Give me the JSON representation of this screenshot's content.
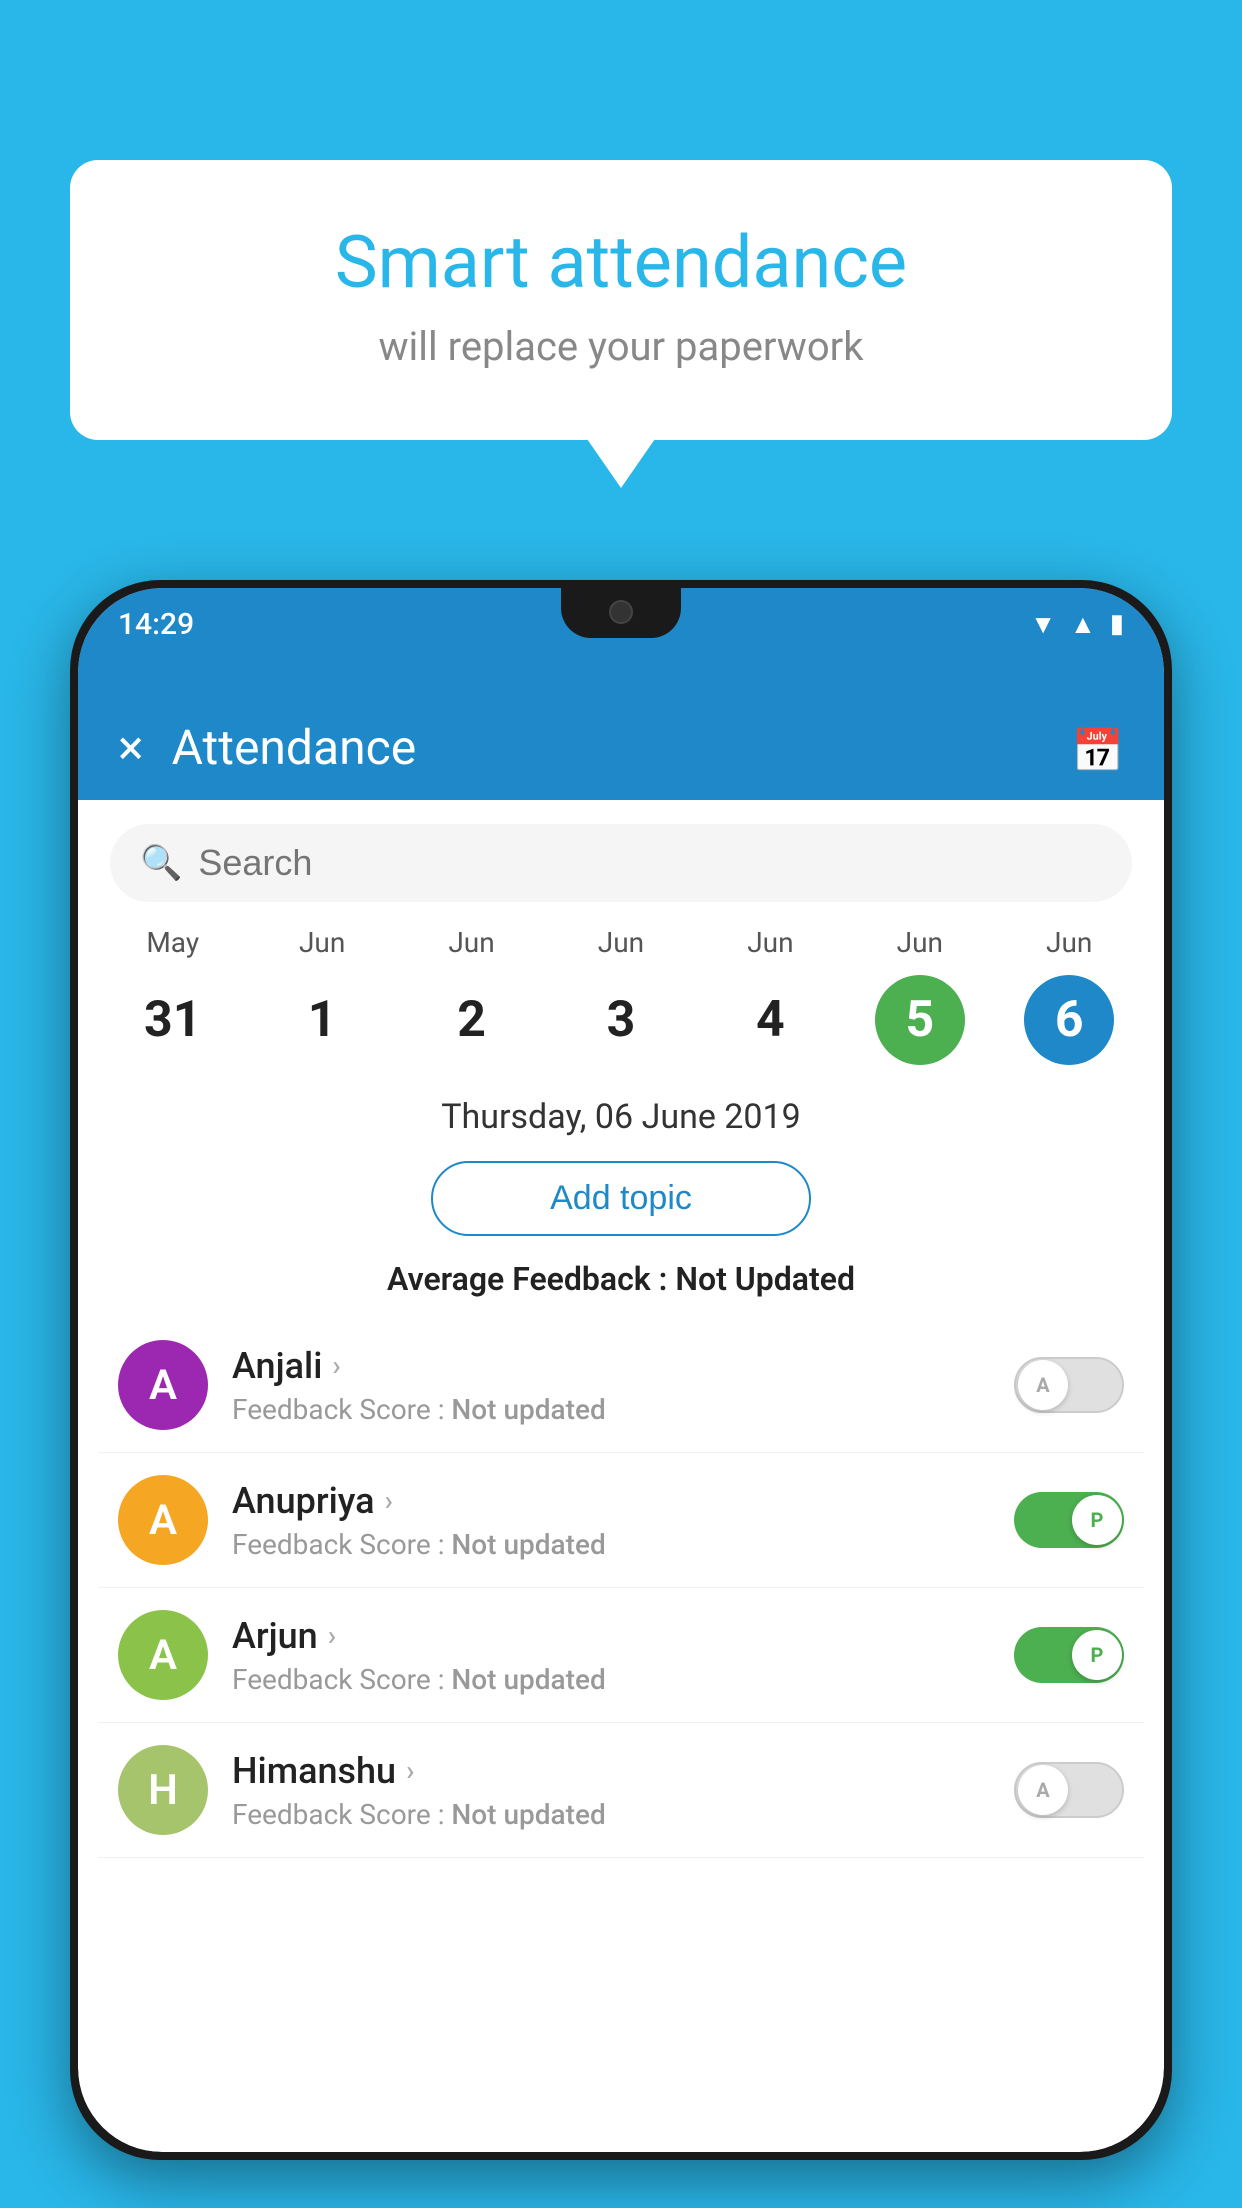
{
  "background_color": "#29b6e8",
  "speech_bubble": {
    "title": "Smart attendance",
    "subtitle": "will replace your paperwork"
  },
  "status_bar": {
    "time": "14:29",
    "icons": [
      "wifi",
      "signal",
      "battery"
    ]
  },
  "app_bar": {
    "title": "Attendance",
    "close_label": "×",
    "calendar_icon": "📅"
  },
  "search": {
    "placeholder": "Search"
  },
  "dates": [
    {
      "month": "May",
      "day": "31",
      "style": "normal"
    },
    {
      "month": "Jun",
      "day": "1",
      "style": "normal"
    },
    {
      "month": "Jun",
      "day": "2",
      "style": "normal"
    },
    {
      "month": "Jun",
      "day": "3",
      "style": "normal"
    },
    {
      "month": "Jun",
      "day": "4",
      "style": "normal"
    },
    {
      "month": "Jun",
      "day": "5",
      "style": "today"
    },
    {
      "month": "Jun",
      "day": "6",
      "style": "selected"
    }
  ],
  "selected_date_label": "Thursday, 06 June 2019",
  "add_topic_label": "Add topic",
  "avg_feedback": {
    "label": "Average Feedback : ",
    "value": "Not Updated"
  },
  "students": [
    {
      "name": "Anjali",
      "avatar_letter": "A",
      "avatar_color": "#9c27b0",
      "feedback": "Feedback Score : ",
      "feedback_value": "Not updated",
      "toggle_state": "off",
      "toggle_label": "A"
    },
    {
      "name": "Anupriya",
      "avatar_letter": "A",
      "avatar_color": "#f5a623",
      "feedback": "Feedback Score : ",
      "feedback_value": "Not updated",
      "toggle_state": "on",
      "toggle_label": "P"
    },
    {
      "name": "Arjun",
      "avatar_letter": "A",
      "avatar_color": "#8bc34a",
      "feedback": "Feedback Score : ",
      "feedback_value": "Not updated",
      "toggle_state": "on",
      "toggle_label": "P"
    },
    {
      "name": "Himanshu",
      "avatar_letter": "H",
      "avatar_color": "#a5c46c",
      "feedback": "Feedback Score : ",
      "feedback_value": "Not updated",
      "toggle_state": "off",
      "toggle_label": "A"
    }
  ]
}
